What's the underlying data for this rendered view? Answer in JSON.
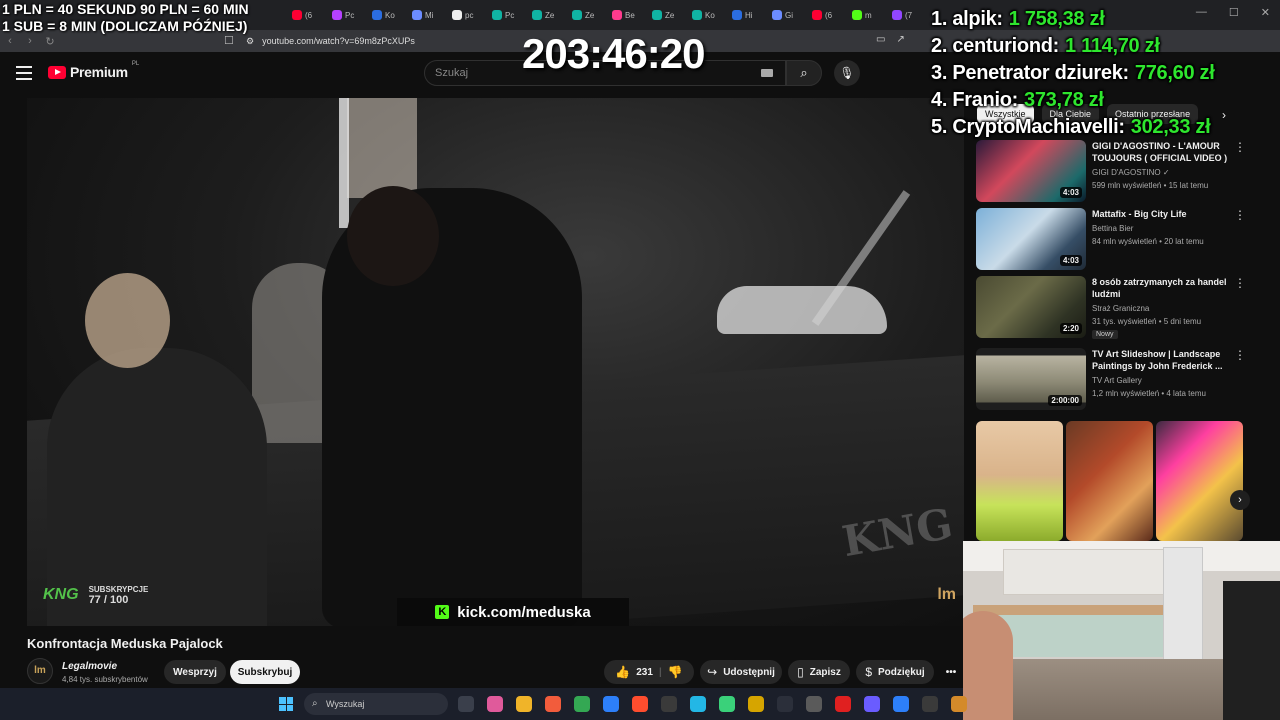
{
  "browser": {
    "url": "youtube.com/watch?v=69m8zPcXUPs",
    "tabs": [
      {
        "label": "(6",
        "color": "#ff0033"
      },
      {
        "label": "Pc",
        "color": "#b541ff"
      },
      {
        "label": "Ko",
        "color": "#2b6de0"
      },
      {
        "label": "Mi",
        "color": "#6c8cff"
      },
      {
        "label": "pc",
        "color": "#eeeeee"
      },
      {
        "label": "Pc",
        "color": "#10b3a3"
      },
      {
        "label": "Ze",
        "color": "#10b3a3"
      },
      {
        "label": "Ze",
        "color": "#10b3a3"
      },
      {
        "label": "Be",
        "color": "#ff3b8d"
      },
      {
        "label": "Ze",
        "color": "#10b3a3"
      },
      {
        "label": "Ko",
        "color": "#10b3a3"
      },
      {
        "label": "Hi",
        "color": "#2b6de0"
      },
      {
        "label": "Gi",
        "color": "#6c8cff"
      },
      {
        "label": "(6",
        "color": "#ff0033"
      },
      {
        "label": "m",
        "color": "#53fc18"
      },
      {
        "label": "(7",
        "color": "#9146ff"
      }
    ]
  },
  "youtube": {
    "brand": "Premium",
    "region": "PL",
    "search_placeholder": "Szukaj",
    "video": {
      "title": "Konfrontacja Meduska Pajalock",
      "channel": "Legalmovie",
      "channel_initials": "lm",
      "subscribers": "4,84 tys. subskrybentów",
      "watermark": "KNG",
      "overlay_sub_label": "SUBSKRYPCJE",
      "overlay_sub_count": "77 / 100",
      "overlay_sub_logo": "KNG",
      "kick_letter": "K",
      "kick_url": "kick.com/meduska",
      "corner_mark": "lm"
    },
    "actions": {
      "support": "Wesprzyj",
      "subscribe": "Subskrybuj",
      "likes": "231",
      "share": "Udostępnij",
      "save": "Zapisz",
      "thanks": "Podziękuj",
      "more": "•••"
    },
    "chips": [
      "Wszystkie",
      "Dla Ciebie",
      "Ostatnio przesłane"
    ],
    "recommendations": [
      {
        "title": "GIGI D'AGOSTINO - L'AMOUR TOUJOURS ( OFFICIAL VIDEO )",
        "channel": "GIGI D'AGOSTINO",
        "meta": "599 mln wyświetleń • 15 lat temu",
        "duration": "4:03"
      },
      {
        "title": "Mattafix - Big City Life",
        "channel": "Bettina Bier",
        "meta": "84 mln wyświetleń • 20 lat temu",
        "duration": "4:03"
      },
      {
        "title": "8 osób zatrzymanych za handel ludźmi",
        "channel": "Straż Graniczna",
        "meta": "31 tys. wyświetleń • 5 dni temu",
        "duration": "2:20",
        "badge": "Nowy"
      },
      {
        "title": "TV Art Slideshow | Landscape Paintings by John Frederick ...",
        "channel": "TV Art Gallery",
        "meta": "1,2 mln wyświetleń • 4 lata temu",
        "duration": "2:00:00"
      }
    ]
  },
  "overlay": {
    "donate_rules": [
      "1 PLN = 40 SEKUND 90 PLN = 60 MIN",
      "1 SUB = 8 MIN (DOLICZAM PÓŹNIEJ)"
    ],
    "timer": "203:46:20",
    "leaderboard": [
      {
        "name": "1. alpik:",
        "amount": "1 758,38 zł"
      },
      {
        "name": "2. centuriond:",
        "amount": "1 114,70 zł"
      },
      {
        "name": "3. Penetrator dziurek:",
        "amount": "776,60 zł"
      },
      {
        "name": "4. Franio:",
        "amount": "373,78 zł"
      },
      {
        "name": "5. CryptoMachiavelli:",
        "amount": "302,33 zł"
      }
    ]
  },
  "taskbar": {
    "search_placeholder": "Wyszukaj",
    "apps": [
      "#3a3f4b",
      "#e05a9b",
      "#f0b429",
      "#f25c3c",
      "#34a853",
      "#2d7ff9",
      "#ff4d2e",
      "#3a3a3a",
      "#23b7e5",
      "#3ad17a",
      "#d6a500",
      "#2b2f3a",
      "#5a5a5a",
      "#e02020",
      "#6a5cff",
      "#2d7ff9",
      "#3a3a3a",
      "#d48a2a"
    ]
  }
}
